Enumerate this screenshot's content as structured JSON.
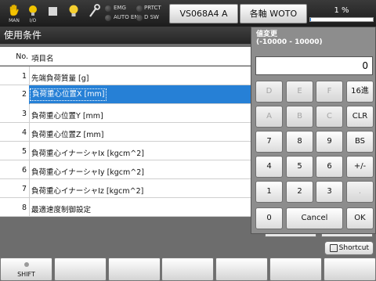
{
  "topbar": {
    "icons": [
      {
        "name": "hand-icon",
        "label": "MAN"
      },
      {
        "name": "io-icon",
        "label": "I/O"
      },
      {
        "name": "stop-square-icon",
        "label": ""
      },
      {
        "name": "lightbulb-icon",
        "label": ""
      },
      {
        "name": "wrench-icon",
        "label": ""
      }
    ],
    "indicators": [
      "EMG",
      "PRTCT",
      "AUTO EN",
      "D SW"
    ],
    "model_button": "VS068A4 A",
    "axis_button": "各軸 WOTO",
    "progress_text": "1 %",
    "progress_value": 1
  },
  "table": {
    "title": "使用条件",
    "header_no": "No.",
    "header_name": "項目名",
    "rows": [
      {
        "no": "1",
        "name": "先端負荷質量 [g]"
      },
      {
        "no": "2",
        "name": "負荷重心位置X [mm]"
      },
      {
        "no": "3",
        "name": "負荷重心位置Y [mm]"
      },
      {
        "no": "4",
        "name": "負荷重心位置Z [mm]"
      },
      {
        "no": "5",
        "name": "負荷重心イナーシャIx [kgcm^2]"
      },
      {
        "no": "6",
        "name": "負荷重心イナーシャIy [kgcm^2]"
      },
      {
        "no": "7",
        "name": "負荷重心イナーシャIz [kgcm^2]"
      },
      {
        "no": "8",
        "name": "最適速度制御設定"
      }
    ],
    "selected_row": 2
  },
  "keypad": {
    "title": "値変更",
    "range": "(-10000 - 10000)",
    "value": "0",
    "keys": {
      "d": "D",
      "e": "E",
      "f": "F",
      "hex": "16進",
      "a": "A",
      "b": "B",
      "c": "C",
      "clr": "CLR",
      "k7": "7",
      "k8": "8",
      "k9": "9",
      "bs": "BS",
      "k4": "4",
      "k5": "5",
      "k6": "6",
      "sign": "+/-",
      "k1": "1",
      "k2": "2",
      "k3": "3",
      "dot": ".",
      "k0": "0",
      "cancel": "Cancel",
      "ok": "OK"
    }
  },
  "footer": {
    "shortcut": "Shortcut",
    "f1": "SHIFT"
  },
  "colors": {
    "selection": "#2680d6",
    "progress": "#1e7ad8",
    "title_bar": "#262626"
  }
}
